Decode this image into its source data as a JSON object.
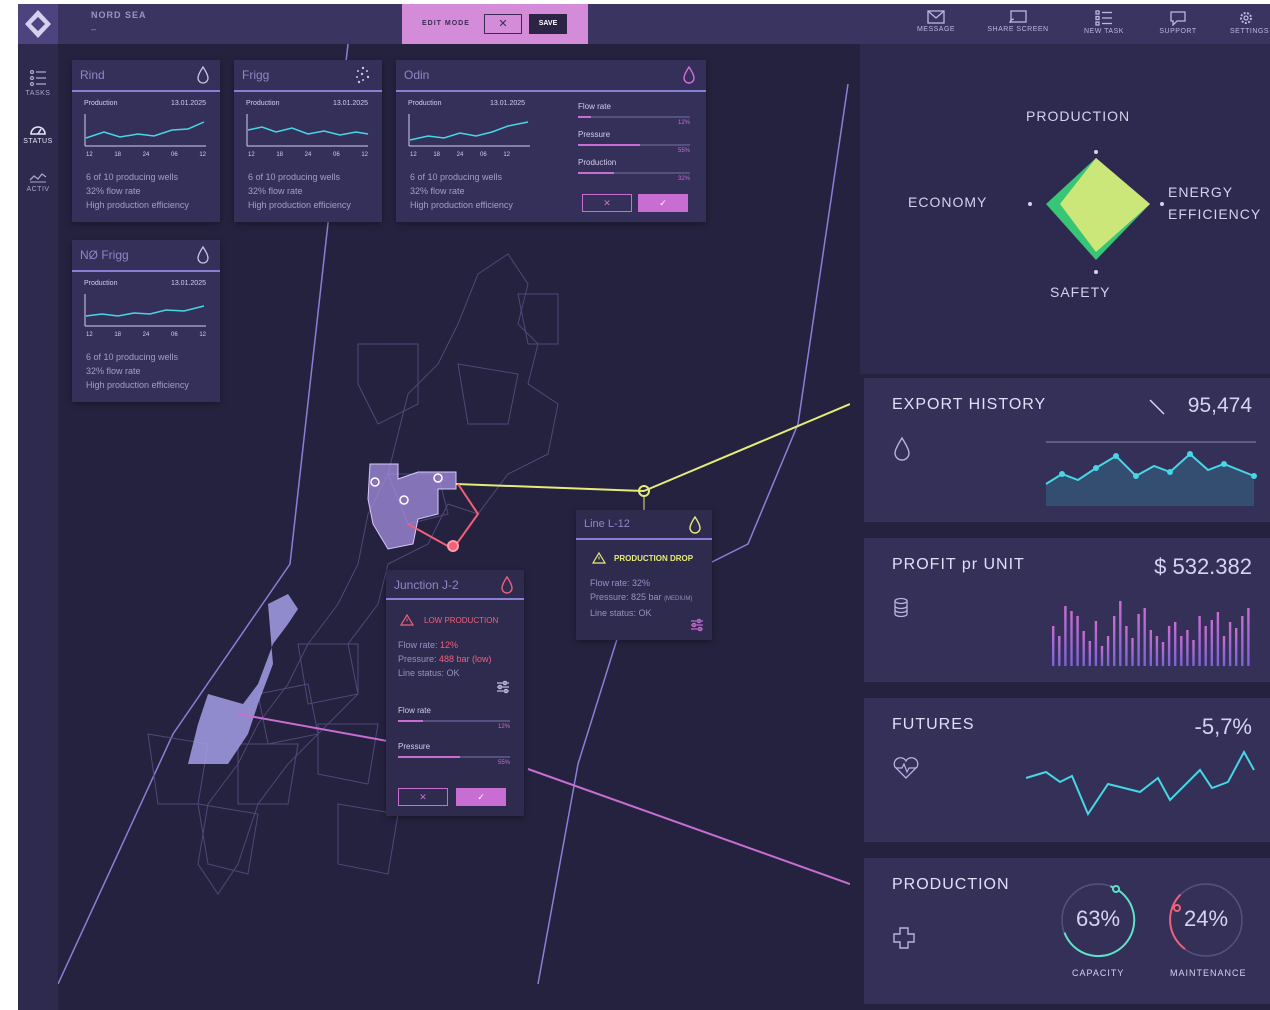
{
  "app": {
    "title": "NORD SEA",
    "subtitle": "–"
  },
  "edit_mode": {
    "label": "EDIT MODE",
    "cancel": "✕",
    "save": "SAVE"
  },
  "sidebar": [
    {
      "label": "TASKS",
      "icon": "list-icon"
    },
    {
      "label": "STATUS",
      "icon": "gauge-icon"
    },
    {
      "label": "ACTIV",
      "icon": "activity-icon"
    }
  ],
  "top_actions": [
    {
      "label": "MESSAGE",
      "icon": "envelope-icon"
    },
    {
      "label": "SHARE SCREEN",
      "icon": "cast-icon"
    },
    {
      "label": "NEW TASK",
      "icon": "checklist-icon"
    },
    {
      "label": "SUPPORT",
      "icon": "chat-icon"
    },
    {
      "label": "SETTINGS",
      "icon": "gear-icon"
    }
  ],
  "fields": [
    {
      "name": "Rind",
      "chart_label": "Production",
      "date": "13.01.2025",
      "ticks": [
        "12",
        "18",
        "24",
        "06",
        "12"
      ],
      "lines": [
        "6 of 10 producing wells",
        "32% flow rate",
        "High production efficiency"
      ]
    },
    {
      "name": "Frigg",
      "chart_label": "Production",
      "date": "13.01.2025",
      "ticks": [
        "12",
        "18",
        "24",
        "06",
        "12"
      ],
      "lines": [
        "6 of 10 producing wells",
        "32% flow rate",
        "High production efficiency"
      ]
    },
    {
      "name": "Odin",
      "chart_label": "Production",
      "date": "13.01.2025",
      "ticks": [
        "12",
        "18",
        "24",
        "06",
        "12"
      ],
      "lines": [
        "6 of 10 producing wells",
        "32% flow rate",
        "High production efficiency"
      ]
    },
    {
      "name": "NØ Frigg",
      "chart_label": "Production",
      "date": "13.01.2025",
      "ticks": [
        "12",
        "18",
        "24",
        "06",
        "12"
      ],
      "lines": [
        "6 of 10 producing wells",
        "32% flow rate",
        "High production efficiency"
      ]
    }
  ],
  "odin_sliders": [
    {
      "label": "Flow rate",
      "value": "12%",
      "fraction": 0.12
    },
    {
      "label": "Pressure",
      "value": "55%",
      "fraction": 0.55
    },
    {
      "label": "Production",
      "value": "32%",
      "fraction": 0.32
    }
  ],
  "odin_buttons": {
    "cancel": "✕",
    "ok": "✓"
  },
  "line": {
    "name": "Line L-12",
    "alert": "PRODUCTION DROP",
    "flow": "Flow rate: 32%",
    "pressure": "Pressure: 825 bar",
    "pressure_tag": "(MEDIUM)",
    "status": "Line status: OK"
  },
  "junction": {
    "name": "Junction J-2",
    "alert": "LOW PRODUCTION",
    "flow_label": "Flow rate:",
    "flow_value": "12%",
    "pressure_label": "Pressure:",
    "pressure_value": "488 bar (low)",
    "status": "Line status: OK",
    "sliders": [
      {
        "label": "Flow rate",
        "value": "12%",
        "fraction": 0.12
      },
      {
        "label": "Pressure",
        "value": "55%",
        "fraction": 0.55
      }
    ],
    "cancel": "✕",
    "ok": "✓"
  },
  "radar": {
    "top": "PRODUCTION",
    "left": "ECONOMY",
    "right_line1": "ENERGY",
    "right_line2": "EFFICIENCY",
    "bottom": "SAFETY"
  },
  "export_history": {
    "title": "EXPORT HISTORY",
    "value": "95,474",
    "trend_icon": "arrow-down-icon",
    "icon": "drop-icon"
  },
  "profit": {
    "title": "PROFIT pr UNIT",
    "value": "$ 532.382",
    "icon": "coins-icon"
  },
  "futures": {
    "title": "FUTURES",
    "value": "-5,7%",
    "icon": "heartbeat-icon"
  },
  "production": {
    "title": "PRODUCTION",
    "icon": "plus-icon",
    "gauges": [
      {
        "value": "63%",
        "fraction": 0.63,
        "label": "CAPACITY",
        "color": "#5fe0c7"
      },
      {
        "value": "24%",
        "fraction": 0.24,
        "label": "MAINTENANCE",
        "color": "#f0607a"
      }
    ]
  },
  "colors": {
    "accent_pink": "#c86ed2",
    "accent_yellow": "#e6ec7a",
    "accent_cyan": "#46d7e6",
    "accent_violet": "#8a7fd6",
    "alert_red": "#f0607a"
  }
}
